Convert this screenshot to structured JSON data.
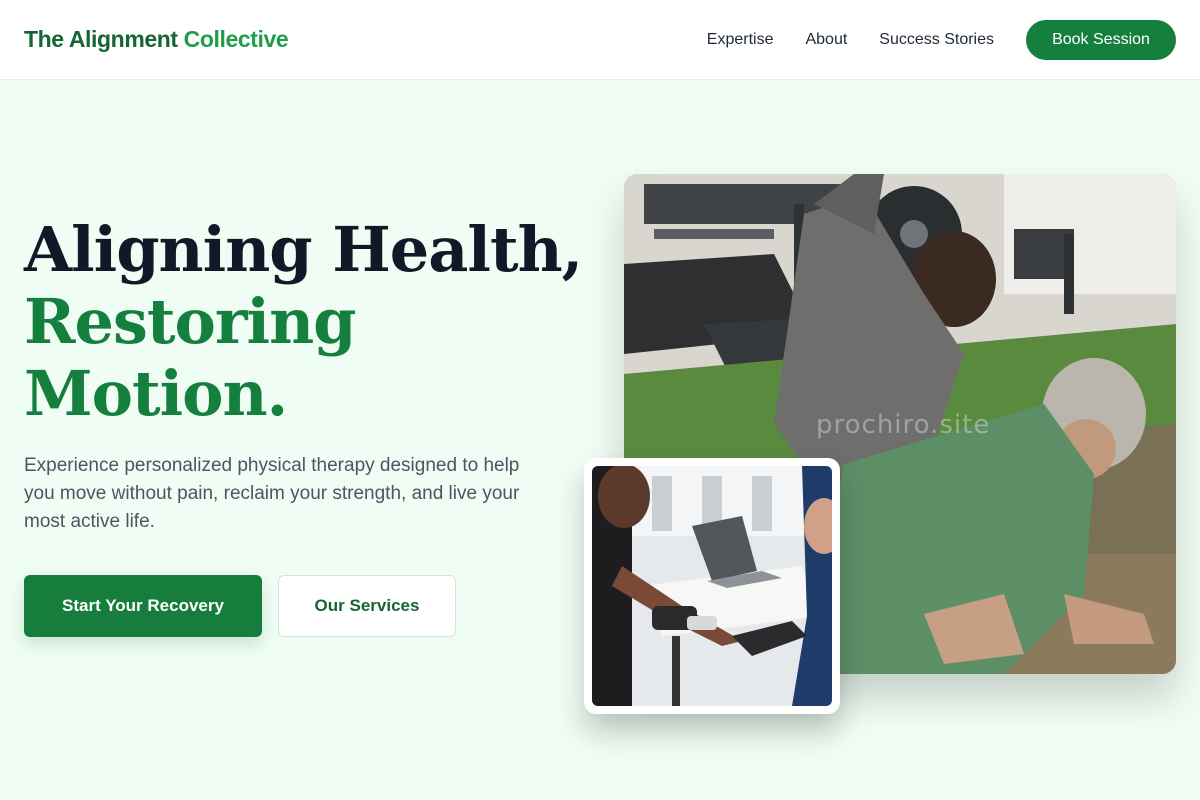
{
  "header": {
    "logo_primary": "The Alignment",
    "logo_accent": "Collective",
    "nav": [
      "Expertise",
      "About",
      "Success Stories"
    ],
    "cta_label": "Book Session"
  },
  "hero": {
    "title_line1": "Aligning Health,",
    "title_line2": "Restoring",
    "title_line3": "Motion.",
    "description": "Experience personalized physical therapy designed to help you move without pain, reclaim your strength, and live your most active life.",
    "primary_cta": "Start Your Recovery",
    "secondary_cta": "Our Services"
  },
  "images": {
    "main_alt": "Therapist stretching with an older patient in a gym",
    "inset_alt": "Therapist fitting a prosthetic hand on a patient",
    "watermark": "prochiro.site"
  },
  "colors": {
    "brand_dark": "#166534",
    "brand": "#15803d",
    "brand_light": "#1f9d4a",
    "background": "#f0fdf4",
    "text_dark": "#111827",
    "text_muted": "#4b5563"
  }
}
